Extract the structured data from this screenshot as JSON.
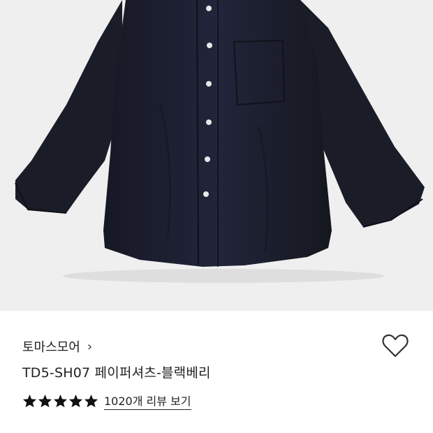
{
  "product": {
    "brand": "토마스모어",
    "brand_chevron": "›",
    "title": "TD5-SH07 페이퍼셔츠-블랙베리",
    "rating_stars": 5,
    "reviews_link": "1020개 리뷰 보기",
    "wishlist_icon": "heart-outline-icon"
  },
  "colors": {
    "photo_background": "#efefef",
    "shirt": "#1c1e2a",
    "text": "#222222"
  }
}
